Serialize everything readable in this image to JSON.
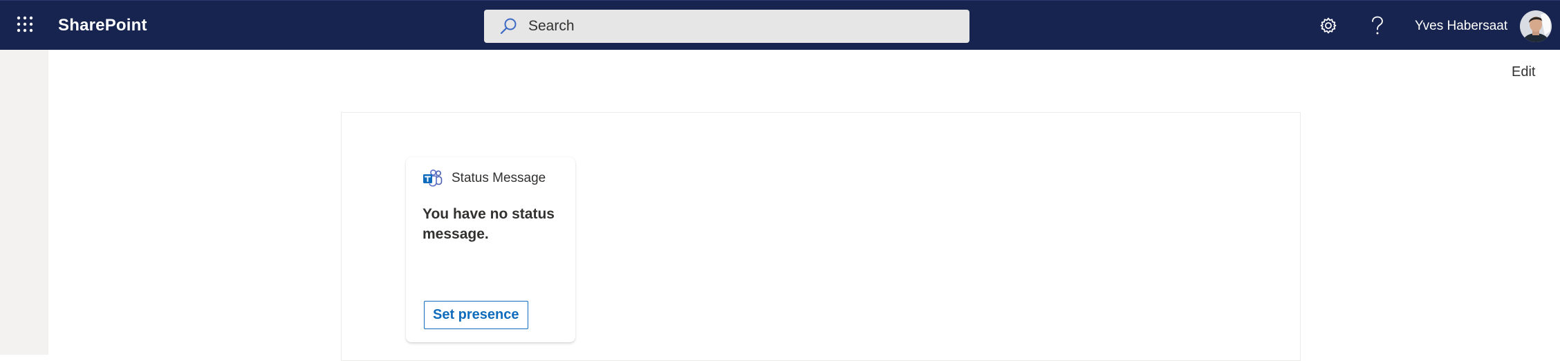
{
  "header": {
    "app_name": "SharePoint",
    "search_placeholder": "Search",
    "user_name": "Yves Habersaat",
    "brand_color": "#17244f",
    "icons": [
      "app-launcher-icon",
      "search-icon",
      "gear-icon",
      "help-icon"
    ]
  },
  "page": {
    "edit_label": "Edit"
  },
  "card": {
    "title": "Status Message",
    "icon": "teams-icon",
    "message": "You have no status message.",
    "button_label": "Set presence",
    "accent_color": "#0f6cbd"
  }
}
